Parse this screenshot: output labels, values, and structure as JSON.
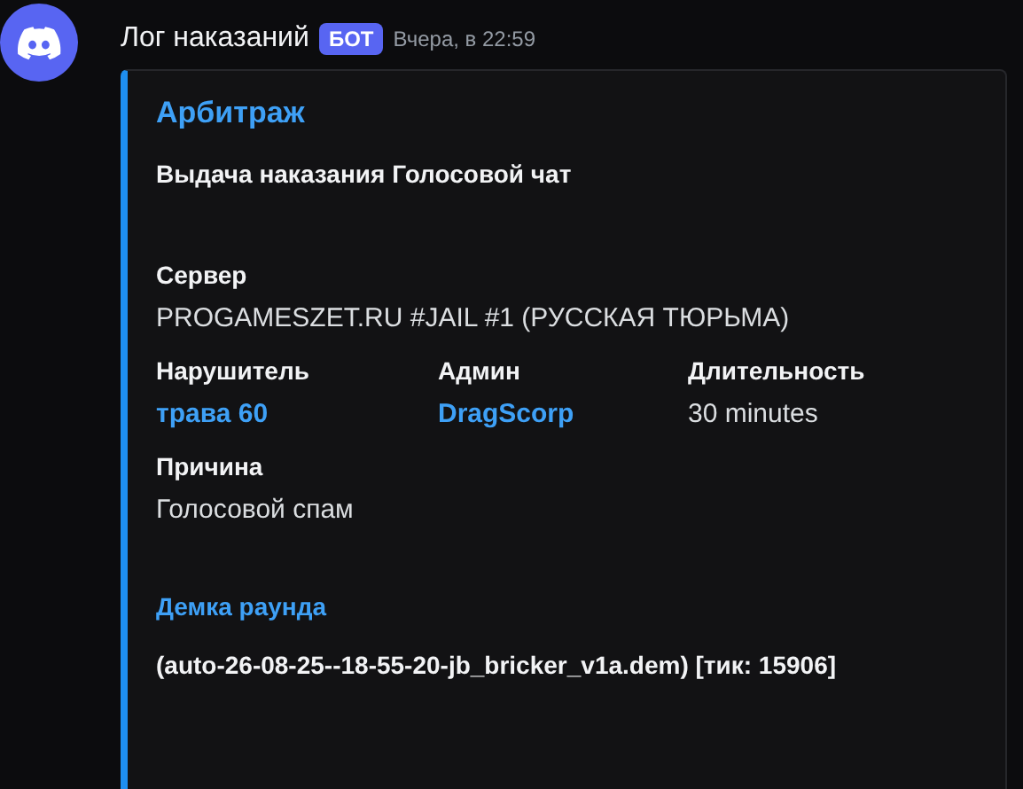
{
  "message": {
    "author": "Лог наказаний",
    "bot_tag": "БОТ",
    "timestamp": "Вчера, в 22:59"
  },
  "embed": {
    "color": "#1e8ef0",
    "title": "Арбитраж",
    "description": "Выдача наказания Голосовой чат",
    "fields": [
      {
        "kind": "text",
        "name": "Сервер",
        "value": "PROGAMESZET.RU #JAIL #1 (РУССКАЯ ТЮРЬМА)",
        "inline": false
      },
      {
        "kind": "mention",
        "name": "Нарушитель",
        "value": "трава 60",
        "inline": true
      },
      {
        "kind": "mention",
        "name": "Админ",
        "value": "DragScorp",
        "inline": true
      },
      {
        "kind": "text",
        "name": "Длительность",
        "value": "30 minutes",
        "inline": true
      },
      {
        "kind": "text",
        "name": "Причина",
        "value": "Голосовой спам",
        "inline": false
      },
      {
        "kind": "demo",
        "name": "Демка раунда",
        "value": "(auto-26-08-25--18-55-20-jb_bricker_v1a.dem) [тик: 15906]",
        "inline": false
      }
    ]
  }
}
